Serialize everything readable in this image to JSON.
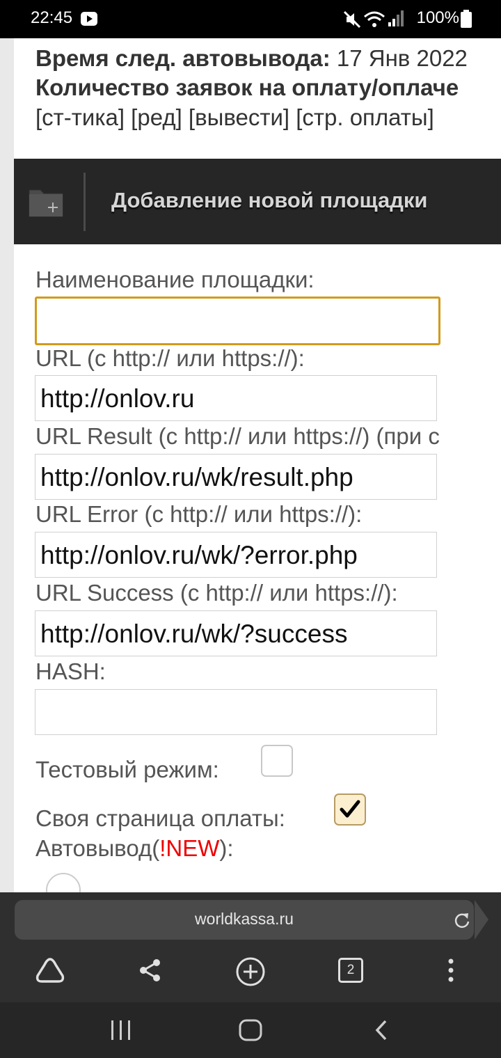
{
  "status_bar": {
    "time": "22:45",
    "battery": "100%"
  },
  "account": {
    "autopayout_label": "Время след. автовывода:",
    "autopayout_value": "17 Янв 2022",
    "requests_label": "Количество заявок на оплату/оплаче",
    "links": "[ст-тика] [ред] [вывести] [стр. оплаты]"
  },
  "panel": {
    "title": "Добавление новой площадки"
  },
  "form": {
    "name_label": "Наименование площадки:",
    "name_value": "",
    "url_label": "URL (с http:// или https://):",
    "url_value": "http://onlov.ru",
    "result_label": "URL Result (с http:// или https://) (при с",
    "result_value": "http://onlov.ru/wk/result.php",
    "error_label": "URL Error (с http:// или https://):",
    "error_value": "http://onlov.ru/wk/?error.php",
    "success_label": "URL Success (с http:// или https://):",
    "success_value": "http://onlov.ru/wk/?success",
    "hash_label": "HASH:",
    "hash_value": "",
    "test_mode_label": "Тестовый режим:",
    "test_mode_checked": false,
    "own_page_label": "Своя страница оплаты:",
    "own_page_checked": true,
    "autopayout_label": "Автовывод(",
    "new_badge": "!NEW",
    "autopayout_suffix": "):"
  },
  "browser": {
    "url": "worldkassa.ru",
    "tab_count": "2"
  },
  "colors": {
    "focus_border": "#d29a1b",
    "new_badge": "#e00000",
    "panel_bg": "#262626"
  }
}
